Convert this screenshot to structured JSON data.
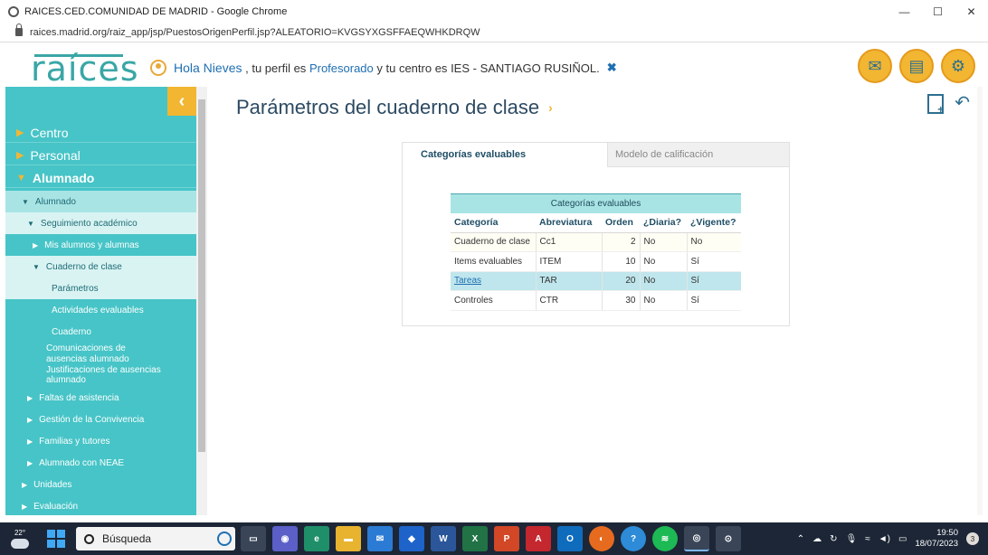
{
  "browser": {
    "window_title": "RAICES.CED.COMUNIDAD DE MADRID - Google Chrome",
    "url": "raices.madrid.org/raiz_app/jsp/PuestosOrigenPerfil.jsp?ALEATORIO=KVGSYXGSFFAEQWHKDRQW",
    "minimize": "—",
    "maximize": "☐",
    "close": "✕"
  },
  "header": {
    "logo": "raíces",
    "greeting": "Hola Nieves",
    "profile_prefix": ", tu perfil es",
    "profile": "Profesorado",
    "center_prefix": "y tu centro es",
    "center": "IES - SANTIAGO RUSIÑOL."
  },
  "sidebar": {
    "collapse": "‹",
    "items": [
      {
        "label": "Centro"
      },
      {
        "label": "Personal"
      },
      {
        "label": "Alumnado"
      },
      {
        "label": "Alumnado"
      },
      {
        "label": "Seguimiento académico"
      },
      {
        "label": "Mis alumnos y alumnas"
      },
      {
        "label": "Cuaderno de clase"
      },
      {
        "label": "Parámetros"
      },
      {
        "label": "Actividades evaluables"
      },
      {
        "label": "Cuaderno"
      },
      {
        "label": "Comunicaciones de ausencias alumnado"
      },
      {
        "label": "Justificaciones de ausencias alumnado"
      },
      {
        "label": "Faltas de asistencia"
      },
      {
        "label": "Gestión de la Convivencia"
      },
      {
        "label": "Familias y tutores"
      },
      {
        "label": "Alumnado con NEAE"
      },
      {
        "label": "Unidades"
      },
      {
        "label": "Evaluación"
      }
    ]
  },
  "main": {
    "title": "Parámetros del cuaderno de clase",
    "tabs": [
      {
        "label": "Categorías evaluables"
      },
      {
        "label": "Modelo de calificación"
      }
    ],
    "table": {
      "caption": "Categorías evaluables",
      "headers": [
        "Categoría",
        "Abreviatura",
        "Orden",
        "¿Diaria?",
        "¿Vigente?"
      ],
      "rows": [
        {
          "categoria": "Cuaderno de clase",
          "abreviatura": "Cc1",
          "orden": "2",
          "diaria": "No",
          "vigente": "No"
        },
        {
          "categoria": "Items evaluables",
          "abreviatura": "ITEM",
          "orden": "10",
          "diaria": "No",
          "vigente": "Sí"
        },
        {
          "categoria": "Tareas",
          "abreviatura": "TAR",
          "orden": "20",
          "diaria": "No",
          "vigente": "Sí"
        },
        {
          "categoria": "Controles",
          "abreviatura": "CTR",
          "orden": "30",
          "diaria": "No",
          "vigente": "Sí"
        }
      ]
    }
  },
  "taskbar": {
    "temperature": "22°",
    "search_placeholder": "Búsqueda",
    "time": "19:50",
    "date": "18/07/2023",
    "notifications": "3"
  }
}
